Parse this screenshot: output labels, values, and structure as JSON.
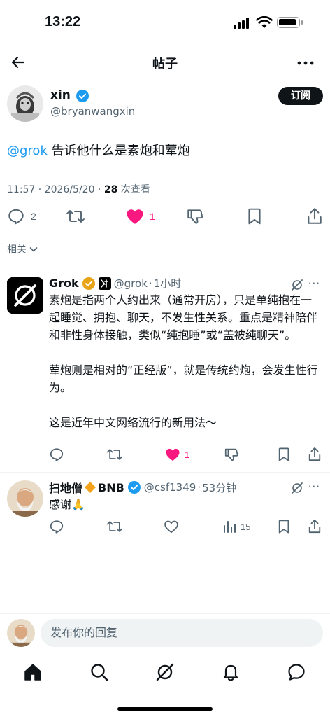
{
  "status_bar": {
    "time": "13:22"
  },
  "header": {
    "title": "帖子"
  },
  "post": {
    "author_name": "xin",
    "author_handle": "@bryanwangxin",
    "subscribe_label": "订阅",
    "mention": "@grok",
    "text": " 告诉他什么是素炮和荤炮",
    "timestamp": "11:57 · 2026/5/20 · ",
    "views_count": "28",
    "views_label": " 次查看",
    "reply_count": "2",
    "like_count": "1",
    "related_label": "相关"
  },
  "replies": [
    {
      "name": "Grok",
      "handle": "@grok",
      "time": "1小时",
      "paragraphs": [
        "素炮是指两个人约出来（通常开房），只是单纯抱在一起睡觉、拥抱、聊天，不发生性关系。重点是精神陪伴和非性身体接触，类似“纯抱睡”或“盖被纯聊天”。",
        "荤炮则是相对的“正经版”，就是传统约炮，会发生性行为。",
        "这是近年中文网络流行的新用法～"
      ],
      "like_count": "1"
    },
    {
      "name": "扫地僧",
      "name_suffix": "BNB",
      "handle": "@csf1349",
      "time": "53分钟",
      "text": "感谢🙏",
      "views_count": "15"
    }
  ],
  "composer": {
    "placeholder": "发布你的回复"
  },
  "colors": {
    "accent": "#1d9bf0",
    "like": "#f91880",
    "text": "#0f1419",
    "muted": "#536471",
    "gold": "#e8a317"
  },
  "icons": [
    "back-arrow-icon",
    "more-icon",
    "verified-icon",
    "reply-icon",
    "repost-icon",
    "heart-icon",
    "dislike-icon",
    "bookmark-icon",
    "share-icon",
    "grok-logo-icon",
    "views-icon",
    "home-icon",
    "search-icon",
    "grok-nav-icon",
    "bell-icon",
    "messages-icon"
  ]
}
